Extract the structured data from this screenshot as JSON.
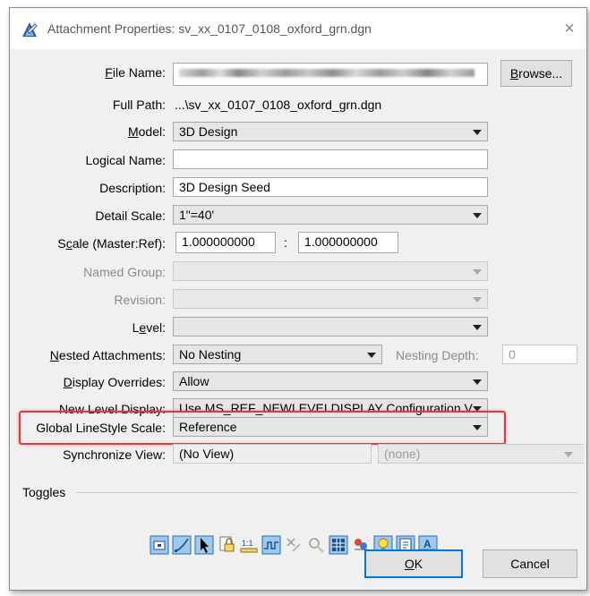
{
  "title_bar": {
    "title": "Attachment Properties: sv_xx_0107_0108_oxford_grn.dgn",
    "close_glyph": "×"
  },
  "labels": {
    "file_name": "File Name:",
    "full_path": "Full Path:",
    "model": "Model:",
    "logical_name": "Logical Name:",
    "description": "Description:",
    "detail_scale": "Detail Scale:",
    "scale": "Scale (Master:Ref):",
    "named_group": "Named Group:",
    "revision": "Revision:",
    "level": "Level:",
    "nested_attachments": "Nested Attachments:",
    "nesting_depth": "Nesting Depth:",
    "display_overrides": "Display Overrides:",
    "new_level_display": "New Level Display:",
    "global_linestyle_scale": "Global LineStyle Scale:",
    "synchronize_view": "Synchronize View:",
    "toggles": "Toggles"
  },
  "values": {
    "full_path": "...\\sv_xx_0107_0108_oxford_grn.dgn",
    "model": "3D Design",
    "logical_name": "",
    "description": "3D Design Seed",
    "detail_scale": "1\"=40'",
    "scale_master": "1.000000000",
    "scale_separator": ":",
    "scale_ref": "1.000000000",
    "named_group": "",
    "revision": "",
    "level": "",
    "nested_attachments": "No Nesting",
    "nesting_depth": "0",
    "display_overrides": "Allow",
    "new_level_display": "Use MS_REF_NEWLEVELDISPLAY Configuration V",
    "global_linestyle_scale": "Reference",
    "synchronize_view": "(No View)",
    "synchronize_secondary": "(none)"
  },
  "buttons": {
    "browse": "Browse...",
    "ok": "OK",
    "cancel": "Cancel"
  },
  "toggles": [
    {
      "icon": "display-toggle-icon",
      "text": ""
    },
    {
      "icon": "snap-toggle-icon",
      "text": ""
    },
    {
      "icon": "locate-toggle-icon",
      "text": ""
    },
    {
      "icon": "lock-toggle-icon",
      "text": ""
    },
    {
      "icon": "true-scale-toggle-icon",
      "text": "1:1"
    },
    {
      "icon": "scale-linestyles-toggle-icon",
      "text": ""
    },
    {
      "icon": "ignore-attachment-toggle-icon",
      "text": ""
    },
    {
      "icon": "display-raster-toggle-icon",
      "text": ""
    },
    {
      "icon": "use-lights-toggle-icon",
      "text": ""
    },
    {
      "icon": "tree-toggle-icon",
      "text": ""
    },
    {
      "icon": "lightbulb-toggle-icon",
      "text": ""
    },
    {
      "icon": "book-toggle-icon",
      "text": ""
    },
    {
      "icon": "annotation-toggle-icon",
      "text": "A"
    }
  ],
  "colors": {
    "highlight": "#e8343a",
    "accent": "#0078d7"
  }
}
